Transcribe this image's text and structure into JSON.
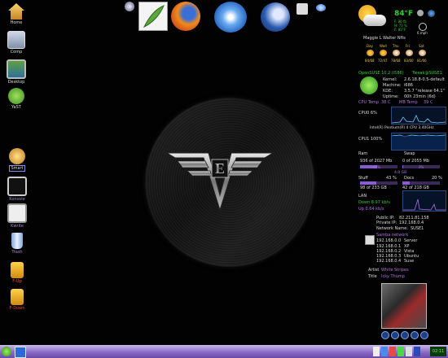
{
  "desktop_icons": [
    {
      "label": "Home",
      "icon": "home-icon"
    },
    {
      "label": "Comp",
      "icon": "computer-icon"
    },
    {
      "label": "Desktop",
      "icon": "desktop-icon"
    },
    {
      "label": "YaST",
      "icon": "yast-icon"
    },
    {
      "label": "Smart",
      "icon": "smart-icon"
    },
    {
      "label": "Konsole",
      "icon": "konsole-icon"
    },
    {
      "label": "Kwrite",
      "icon": "kwrite-icon"
    },
    {
      "label": "Trash",
      "icon": "trash-icon"
    },
    {
      "label": "F-Up",
      "icon": "lock-icon"
    },
    {
      "label": "F-Down",
      "icon": "unlock-icon"
    }
  ],
  "weather": {
    "temp": "84°F",
    "line1": "F: 80 fb",
    "line2": "H: 73 %",
    "line3": "F: 83°F",
    "location": "Maggie L Walter Nfts",
    "speed": "6 mph",
    "days": [
      "Day",
      "Wed",
      "Thu",
      "Fri",
      "Sat"
    ],
    "temps": [
      "84/68",
      "72/47",
      "78/68",
      "83/60",
      "81/66"
    ]
  },
  "system": {
    "distro": "OpenSUSE 10.2 (i586)",
    "user": "Tweak@SUSE1",
    "kernel_label": "Kernel:",
    "kernel": "2.6.18.8-0.5-default",
    "machine_label": "Machine:",
    "machine": "i686",
    "kde_label": "KDE:",
    "kde": "3.5.7 \"release 64.1\"",
    "uptime_label": "Uptime:",
    "uptime": "00h 23min (6d)",
    "cpu_temp_label": "CPU Temp",
    "cpu_temp": "38 C",
    "mb_temp_label": "MB Temp",
    "mb_temp": "39 C",
    "cpu0": "CPU0 6%",
    "cpu_model": "Intel(R) Pentium(R) 4 CPU 3.40GHz",
    "cpu1": "CPU1 100%"
  },
  "memory": {
    "ram_label": "Ram",
    "swap_label": "Swap",
    "ram": "936 of 2027 Mb",
    "swap": "0 of 2055 Mb",
    "ram_pct": "46%",
    "swap_pct": "0%",
    "ram_fill": 0.46,
    "swap_fill": 0.02,
    "free": "4.8 GB",
    "stuff_label": "Stuff",
    "stuff_pct": "43 %",
    "docs_label": "Docs",
    "docs_pct": "20 %",
    "stuff_fill": 0.43,
    "docs_fill": 0.2,
    "stuff": "98 of 233 GB",
    "docs": "42 of 218 GB"
  },
  "network": {
    "lan_label": "LAN",
    "down": "Down 8.97 kb/s",
    "up": "Up 0.64 kb/s",
    "public_label": "Public IP:",
    "public_ip": "82.211.81.158",
    "private_label": "Private IP:",
    "private_ip": "192.168.0.4",
    "netname_label": "Network Name:",
    "netname": "SUSE1",
    "samba_label": "Samba network",
    "hosts": [
      {
        "ip": "192.168.0.0",
        "name": "Server"
      },
      {
        "ip": "192.168.0.1",
        "name": "XP"
      },
      {
        "ip": "192.168.0.2",
        "name": "Vista"
      },
      {
        "ip": "192.168.0.3",
        "name": "Ubuntu"
      },
      {
        "ip": "192.168.0.4",
        "name": "Suse"
      }
    ]
  },
  "music": {
    "artist_label": "Artist",
    "artist": "White Stripes",
    "title_label": "Title",
    "title": "Icky Thump"
  },
  "taskbar": {
    "clock": "02:11"
  },
  "colors": {
    "green": "#2fd02f",
    "purple": "#b070e0",
    "taskbar": "#8a6cc8"
  }
}
